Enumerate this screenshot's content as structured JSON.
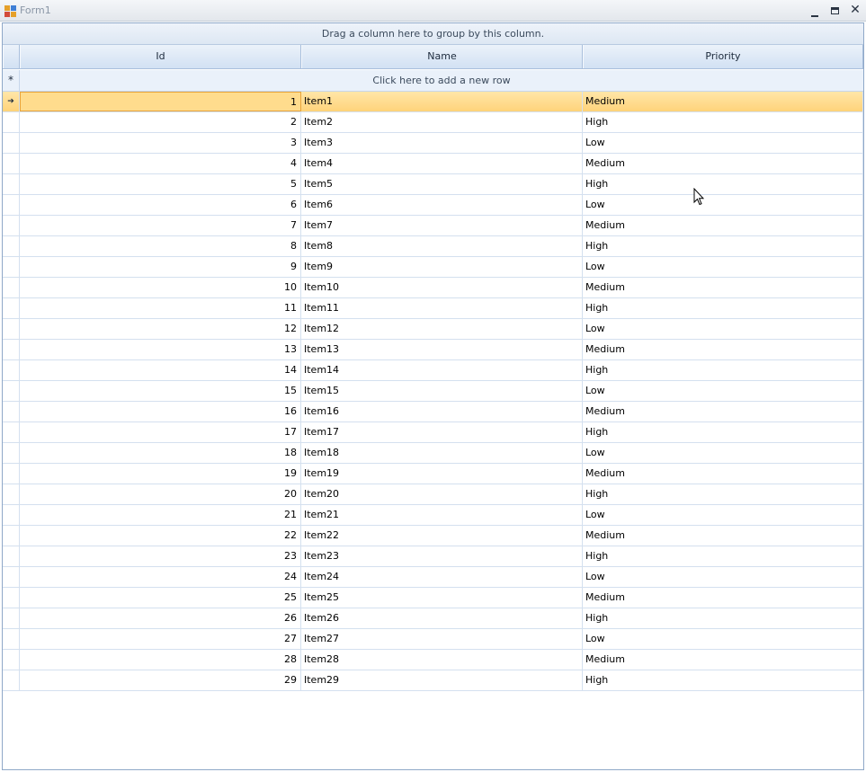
{
  "window": {
    "title": "Form1"
  },
  "grid": {
    "group_panel_text": "Drag a column here to group by this column.",
    "new_row_indicator": "*",
    "new_row_text": "Click here to add a new row",
    "columns": [
      "Id",
      "Name",
      "Priority"
    ],
    "current_row_indicator": "➔",
    "selected_row_index": 0,
    "rows": [
      {
        "id": "1",
        "name": "Item1",
        "priority": "Medium"
      },
      {
        "id": "2",
        "name": "Item2",
        "priority": "High"
      },
      {
        "id": "3",
        "name": "Item3",
        "priority": "Low"
      },
      {
        "id": "4",
        "name": "Item4",
        "priority": "Medium"
      },
      {
        "id": "5",
        "name": "Item5",
        "priority": "High"
      },
      {
        "id": "6",
        "name": "Item6",
        "priority": "Low"
      },
      {
        "id": "7",
        "name": "Item7",
        "priority": "Medium"
      },
      {
        "id": "8",
        "name": "Item8",
        "priority": "High"
      },
      {
        "id": "9",
        "name": "Item9",
        "priority": "Low"
      },
      {
        "id": "10",
        "name": "Item10",
        "priority": "Medium"
      },
      {
        "id": "11",
        "name": "Item11",
        "priority": "High"
      },
      {
        "id": "12",
        "name": "Item12",
        "priority": "Low"
      },
      {
        "id": "13",
        "name": "Item13",
        "priority": "Medium"
      },
      {
        "id": "14",
        "name": "Item14",
        "priority": "High"
      },
      {
        "id": "15",
        "name": "Item15",
        "priority": "Low"
      },
      {
        "id": "16",
        "name": "Item16",
        "priority": "Medium"
      },
      {
        "id": "17",
        "name": "Item17",
        "priority": "High"
      },
      {
        "id": "18",
        "name": "Item18",
        "priority": "Low"
      },
      {
        "id": "19",
        "name": "Item19",
        "priority": "Medium"
      },
      {
        "id": "20",
        "name": "Item20",
        "priority": "High"
      },
      {
        "id": "21",
        "name": "Item21",
        "priority": "Low"
      },
      {
        "id": "22",
        "name": "Item22",
        "priority": "Medium"
      },
      {
        "id": "23",
        "name": "Item23",
        "priority": "High"
      },
      {
        "id": "24",
        "name": "Item24",
        "priority": "Low"
      },
      {
        "id": "25",
        "name": "Item25",
        "priority": "Medium"
      },
      {
        "id": "26",
        "name": "Item26",
        "priority": "High"
      },
      {
        "id": "27",
        "name": "Item27",
        "priority": "Low"
      },
      {
        "id": "28",
        "name": "Item28",
        "priority": "Medium"
      },
      {
        "id": "29",
        "name": "Item29",
        "priority": "High"
      }
    ]
  },
  "colors": {
    "selected_row": "#ffd37a",
    "header": "#d9e6f6",
    "grid_border": "#8fa8c8"
  },
  "icons": [
    "app-icon",
    "minimize-icon",
    "maximize-icon",
    "close-icon",
    "current-row-arrow-icon",
    "mouse-cursor-icon"
  ]
}
